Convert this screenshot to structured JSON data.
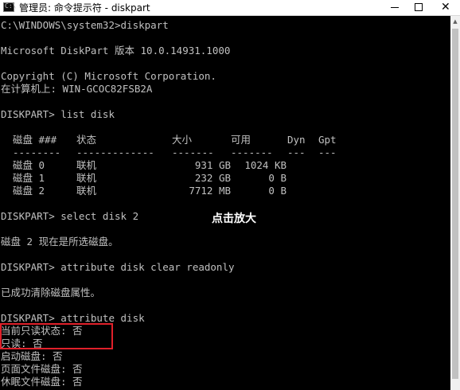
{
  "window": {
    "title": "管理员: 命令提示符 - diskpart",
    "icon_text": "C:\\",
    "close_glyph": "✕"
  },
  "console": {
    "l01": "C:\\WINDOWS\\system32>diskpart",
    "l02": "Microsoft DiskPart 版本 10.0.14931.1000",
    "l03": "Copyright (C) Microsoft Corporation.",
    "l04": "在计算机上: WIN-GCOC82FSB2A",
    "l05": "DISKPART> list disk",
    "l06": "DISKPART> select disk 2",
    "l07": "磁盘 2 现在是所选磁盘。",
    "l08": "DISKPART> attribute disk clear readonly",
    "l09": "已成功清除磁盘属性。",
    "l10": "DISKPART> attribute disk",
    "l11": "当前只读状态: 否",
    "l12": "只读: 否",
    "l13": "启动磁盘: 否",
    "l14": "页面文件磁盘: 否",
    "l15": "休眠文件磁盘: 否"
  },
  "disk_table": {
    "headers": [
      "磁盘 ###",
      "状态",
      "大小",
      "可用",
      "Dyn",
      "Gpt"
    ],
    "separators": [
      "--------",
      "-------------",
      "-------",
      "-------",
      "---",
      "---"
    ],
    "rows": [
      [
        "磁盘 0",
        "联机",
        "931 GB",
        "1024 KB",
        "",
        ""
      ],
      [
        "磁盘 1",
        "联机",
        "232 GB",
        "0 B",
        "",
        ""
      ],
      [
        "磁盘 2",
        "联机",
        "7712 MB",
        "0 B",
        "",
        ""
      ]
    ]
  },
  "annotation": {
    "text": "点击放大"
  },
  "scrollbar": {
    "up_glyph": "▲"
  },
  "colors": {
    "console_bg": "#000000",
    "console_text": "#c0c0c0",
    "highlight": "#e0202a"
  }
}
